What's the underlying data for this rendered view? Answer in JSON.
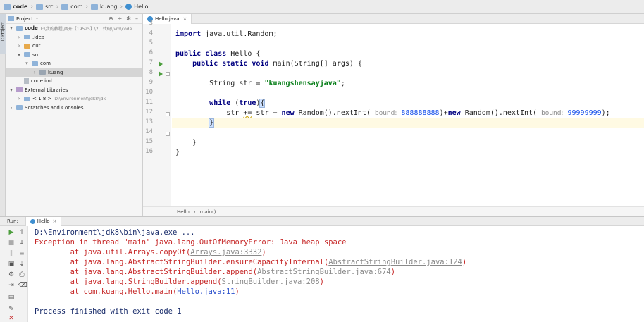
{
  "breadcrumb": [
    {
      "label": "code",
      "kind": "folder"
    },
    {
      "label": "src",
      "kind": "folder"
    },
    {
      "label": "com",
      "kind": "folder"
    },
    {
      "label": "kuang",
      "kind": "folder"
    },
    {
      "label": "Hello",
      "kind": "class"
    }
  ],
  "side_tab": "1: Project",
  "project_panel": {
    "title": "Project",
    "tree": [
      {
        "label": "code",
        "sub": "F:\\我的教程\\西开【19525】\\2、代码\\jvm\\code",
        "indent": 0,
        "arrow": "▾",
        "icon": "folder",
        "bold": true
      },
      {
        "label": ".idea",
        "sub": "",
        "indent": 1,
        "arrow": "›",
        "icon": "folder"
      },
      {
        "label": "out",
        "sub": "",
        "indent": 1,
        "arrow": "›",
        "icon": "orange"
      },
      {
        "label": "src",
        "sub": "",
        "indent": 1,
        "arrow": "▾",
        "icon": "folder"
      },
      {
        "label": "com",
        "sub": "",
        "indent": 2,
        "arrow": "▾",
        "icon": "folder"
      },
      {
        "label": "kuang",
        "sub": "",
        "indent": 3,
        "arrow": "›",
        "icon": "gray",
        "selected": true
      },
      {
        "label": "code.iml",
        "sub": "",
        "indent": 1,
        "arrow": "",
        "icon": "file"
      },
      {
        "label": "External Libraries",
        "sub": "",
        "indent": 0,
        "arrow": "▾",
        "icon": "lib"
      },
      {
        "label": "< 1.8 >",
        "sub": "D:\\Environment\\jdk8\\jdk",
        "indent": 1,
        "arrow": "›",
        "icon": "folder"
      },
      {
        "label": "Scratches and Consoles",
        "sub": "",
        "indent": 0,
        "arrow": "›",
        "icon": "folder"
      }
    ]
  },
  "editor": {
    "tab_label": "Hello.java",
    "line_numbers": [
      "3",
      "4",
      "5",
      "6",
      "7",
      "8",
      "9",
      "10",
      "11",
      "12",
      "13",
      "14",
      "15",
      "16"
    ],
    "code": {
      "import_kw": "import",
      "import_rest": " java.util.Random;",
      "public1": "public",
      "class_kw": " class",
      "class_rest": " Hello {",
      "indent1": "    ",
      "public2": "public",
      "static_kw": " static",
      "void_kw": " void",
      "main_rest": " main(String[] args) {",
      "indent2": "        ",
      "str_decl": "String str = ",
      "str_lit": "\"kuangshensayjava\"",
      "semi": ";",
      "while_kw": "while",
      "while_sp": " (",
      "true_kw": "true",
      "while_close": ")",
      "open_brace": "{",
      "indent3": "            ",
      "str_assign": "str ",
      "plus_eq": "+=",
      "str_plus": " str + ",
      "new1": "new",
      "random1": " Random().nextInt( ",
      "bound1": "bound:",
      "num1": " 888888888",
      "mid": ")+",
      "new2": "new",
      "random2": " Random().nextInt( ",
      "bound2": "bound:",
      "num2": " 99999999",
      "end": ");",
      "close_brace_hl": "}",
      "close_method": "}",
      "close_class": "}"
    },
    "status_path": [
      "Hello",
      "main()"
    ]
  },
  "run_panel": {
    "label": "Run:",
    "tab": "Hello",
    "lines": {
      "cmd": "D:\\Environment\\jdk8\\bin\\java.exe ...",
      "exc": "Exception in thread \"main\" java.lang.OutOfMemoryError: Java heap space",
      "at1_pre": "\tat java.util.Arrays.copyOf(",
      "at1_link": "Arrays.java:3332",
      "at2_pre": "\tat java.lang.AbstractStringBuilder.ensureCapacityInternal(",
      "at2_link": "AbstractStringBuilder.java:124",
      "at3_pre": "\tat java.lang.AbstractStringBuilder.append(",
      "at3_link": "AbstractStringBuilder.java:674",
      "at4_pre": "\tat java.lang.StringBuilder.append(",
      "at4_link": "StringBuilder.java:208",
      "at5_pre": "\tat com.kuang.Hello.main(",
      "at5_link": "Hello.java:11",
      "close": ")",
      "finished": "Process finished with exit code 1"
    }
  }
}
